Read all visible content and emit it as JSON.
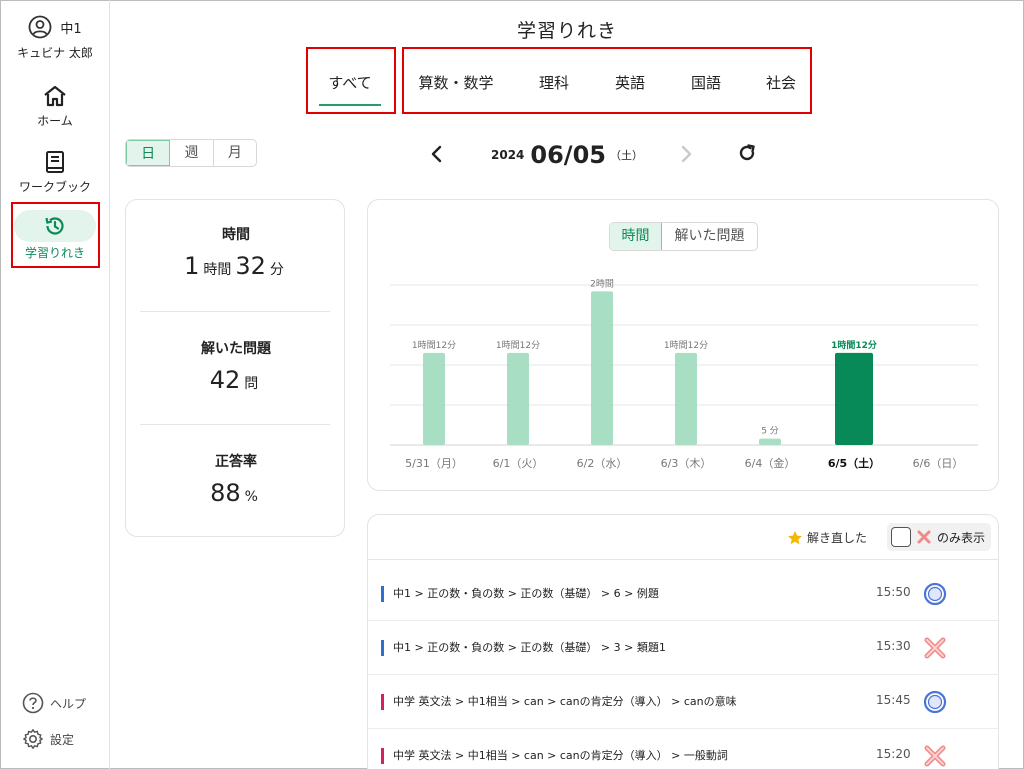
{
  "user": {
    "grade": "中1",
    "name": "キュビナ 太郎"
  },
  "nav": {
    "home": "ホーム",
    "workbook": "ワークブック",
    "history": "学習りれき"
  },
  "footer": {
    "help": "ヘルプ",
    "settings": "設定"
  },
  "page": {
    "title": "学習りれき"
  },
  "tabs": {
    "all": "すべて",
    "math": "算数・数学",
    "science": "理科",
    "english": "英語",
    "japanese": "国語",
    "social": "社会"
  },
  "period": {
    "day": "日",
    "week": "週",
    "month": "月"
  },
  "date": {
    "year": "2024",
    "main": "06/05",
    "dow": "（土）"
  },
  "stats": {
    "time_label": "時間",
    "time_h": "1",
    "time_h_unit": "時間",
    "time_m": "32",
    "time_m_unit": "分",
    "solved_label": "解いた問題",
    "solved_value": "42",
    "solved_unit": "問",
    "accuracy_label": "正答率",
    "accuracy_value": "88",
    "accuracy_unit": "%"
  },
  "metric": {
    "time": "時間",
    "solved": "解いた問題"
  },
  "colors": {
    "accent": "#0c8a58",
    "bar_light": "#a8dec4",
    "bar_active": "#078a58",
    "correct": "#4a74d8",
    "wrong": "#f08a8a"
  },
  "chart_data": {
    "type": "bar",
    "categories": [
      "5/31（月）",
      "6/1（火）",
      "6/2（水）",
      "6/3（木）",
      "6/4（金）",
      "6/5（土）",
      "6/6（日）"
    ],
    "values": [
      72,
      72,
      120,
      72,
      5,
      72,
      0
    ],
    "value_labels": [
      "1時間12分",
      "1時間12分",
      "2時間",
      "1時間12分",
      "5 分",
      "1時間12分",
      ""
    ],
    "selected_index": 5,
    "ylim": [
      0,
      125
    ],
    "grid": true
  },
  "history": {
    "resolved_label": "解き直した",
    "only_label": "のみ表示",
    "rows": [
      {
        "path": "中1 > 正の数・負の数 > 正の数（基礎） > 6 > 例題",
        "time": "15:50",
        "result": "correct",
        "color": "#2f6fd0"
      },
      {
        "path": "中1 > 正の数・負の数 > 正の数（基礎） > 3 > 類題1",
        "time": "15:30",
        "result": "wrong",
        "color": "#2f6fd0"
      },
      {
        "path": "中学 英文法 > 中1相当 > can > canの肯定分（導入） > canの意味",
        "time": "15:45",
        "result": "correct",
        "color": "#d6225a"
      },
      {
        "path": "中学 英文法 > 中1相当 > can > canの肯定分（導入） > 一般動詞",
        "time": "15:20",
        "result": "wrong",
        "color": "#d6225a"
      }
    ]
  }
}
